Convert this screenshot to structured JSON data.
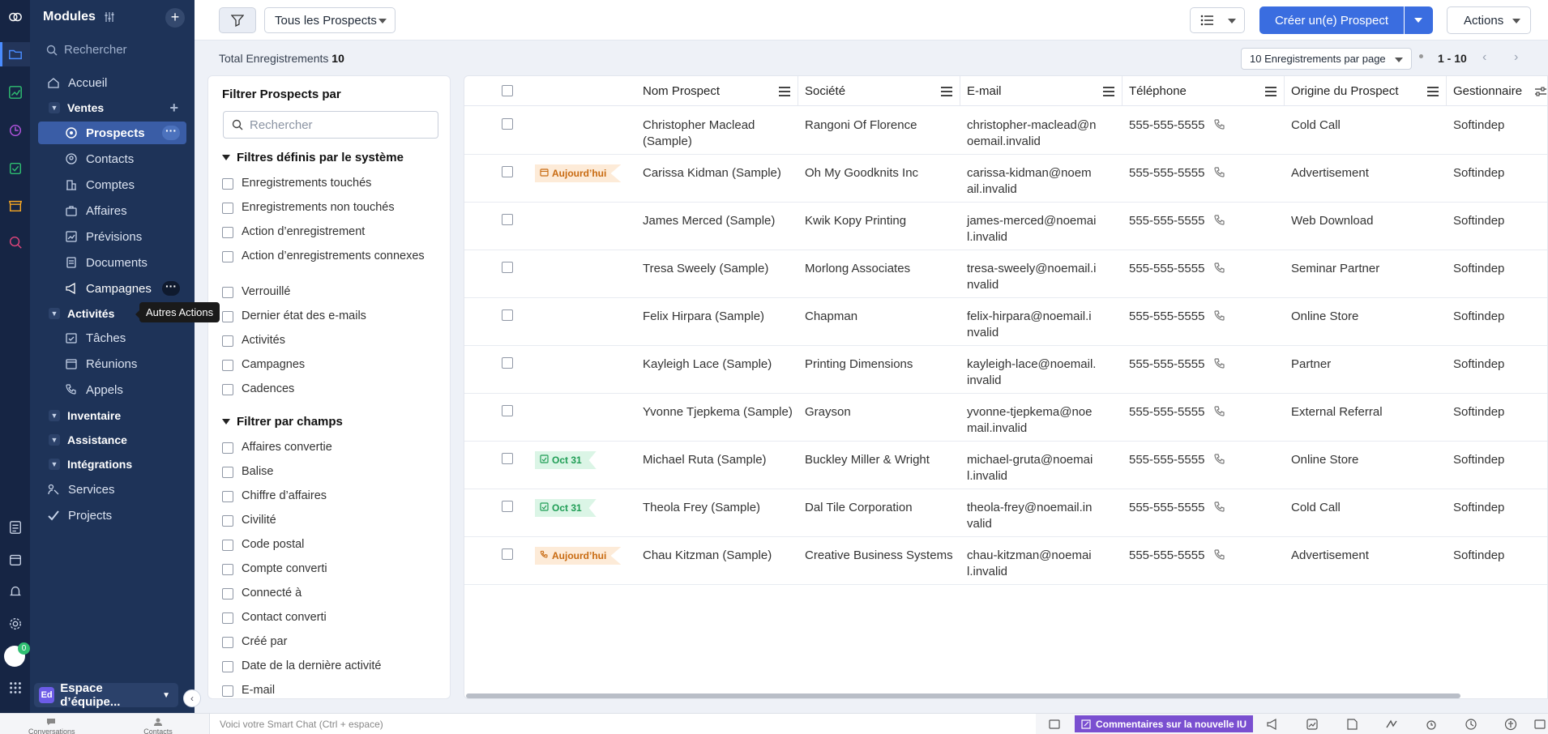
{
  "sidebar": {
    "header": "Modules",
    "search_placeholder": "Rechercher",
    "items": [
      {
        "label": "Accueil"
      },
      {
        "label": "Ventes"
      },
      {
        "label": "Prospects"
      },
      {
        "label": "Contacts"
      },
      {
        "label": "Comptes"
      },
      {
        "label": "Affaires"
      },
      {
        "label": "Prévisions"
      },
      {
        "label": "Documents"
      },
      {
        "label": "Campagnes"
      },
      {
        "label": "Activités"
      },
      {
        "label": "Tâches"
      },
      {
        "label": "Réunions"
      },
      {
        "label": "Appels"
      },
      {
        "label": "Inventaire"
      },
      {
        "label": "Assistance"
      },
      {
        "label": "Intégrations"
      },
      {
        "label": "Services"
      },
      {
        "label": "Projects"
      }
    ],
    "tooltip": "Autres Actions",
    "workspace_badge": "Ed",
    "workspace_label": "Espace d’équipe...",
    "notification_count": "0"
  },
  "toolbar": {
    "view_label": "Tous les Prospects",
    "create_label": "Créer un(e) Prospect",
    "actions_label": "Actions"
  },
  "summary": {
    "total_label": "Total Enregistrements",
    "total_count": "10",
    "per_page": "10 Enregistrements par page",
    "range": "1 - 10"
  },
  "filters": {
    "title": "Filtrer Prospects par",
    "search_placeholder": "Rechercher",
    "system_title": "Filtres définis par le système",
    "system": [
      "Enregistrements touchés",
      "Enregistrements non touchés",
      "Action d’enregistrement",
      "Action d’enregistrements connexes",
      "Verrouillé",
      "Dernier état des e-mails",
      "Activités",
      "Campagnes",
      "Cadences"
    ],
    "fields_title": "Filtrer par champs",
    "fields": [
      "Affaires convertie",
      "Balise",
      "Chiffre d’affaires",
      "Civilité",
      "Code postal",
      "Compte converti",
      "Connecté à",
      "Contact converti",
      "Créé par",
      "Date de la dernière activité",
      "E-mail"
    ]
  },
  "table": {
    "columns": [
      "Nom Prospect",
      "Société",
      "E-mail",
      "Téléphone",
      "Origine du Prospect",
      "Gestionnaire"
    ],
    "rows": [
      {
        "tag": "",
        "tag_type": "",
        "name": "Christopher Maclead (Sample)",
        "company": "Rangoni Of Florence",
        "email": "christopher-maclead@noemail.invalid",
        "phone": "555-555-5555",
        "source": "Cold Call",
        "owner": "Softindep"
      },
      {
        "tag": "Aujourd’hui",
        "tag_type": "today-calendar",
        "name": "Carissa Kidman (Sample)",
        "company": "Oh My Goodknits Inc",
        "email": "carissa-kidman@noemail.invalid",
        "phone": "555-555-5555",
        "source": "Advertisement",
        "owner": "Softindep"
      },
      {
        "tag": "",
        "tag_type": "",
        "name": "James Merced (Sample)",
        "company": "Kwik Kopy Printing",
        "email": "james-merced@noemail.invalid",
        "phone": "555-555-5555",
        "source": "Web Download",
        "owner": "Softindep"
      },
      {
        "tag": "",
        "tag_type": "",
        "name": "Tresa Sweely (Sample)",
        "company": "Morlong Associates",
        "email": "tresa-sweely@noemail.invalid",
        "phone": "555-555-5555",
        "source": "Seminar Partner",
        "owner": "Softindep"
      },
      {
        "tag": "",
        "tag_type": "",
        "name": "Felix Hirpara (Sample)",
        "company": "Chapman",
        "email": "felix-hirpara@noemail.invalid",
        "phone": "555-555-5555",
        "source": "Online Store",
        "owner": "Softindep"
      },
      {
        "tag": "",
        "tag_type": "",
        "name": "Kayleigh Lace (Sample)",
        "company": "Printing Dimensions",
        "email": "kayleigh-lace@noemail.invalid",
        "phone": "555-555-5555",
        "source": "Partner",
        "owner": "Softindep"
      },
      {
        "tag": "",
        "tag_type": "",
        "name": "Yvonne Tjepkema (Sample)",
        "company": "Grayson",
        "email": "yvonne-tjepkema@noemail.invalid",
        "phone": "555-555-5555",
        "source": "External Referral",
        "owner": "Softindep"
      },
      {
        "tag": "Oct 31",
        "tag_type": "date-task",
        "name": "Michael Ruta (Sample)",
        "company": "Buckley Miller & Wright",
        "email": "michael-gruta@noemail.invalid",
        "phone": "555-555-5555",
        "source": "Online Store",
        "owner": "Softindep"
      },
      {
        "tag": "Oct 31",
        "tag_type": "date-task",
        "name": "Theola Frey (Sample)",
        "company": "Dal Tile Corporation",
        "email": "theola-frey@noemail.invalid",
        "phone": "555-555-5555",
        "source": "Cold Call",
        "owner": "Softindep"
      },
      {
        "tag": "Aujourd’hui",
        "tag_type": "today-call",
        "name": "Chau Kitzman (Sample)",
        "company": "Creative Business Systems",
        "email": "chau-kitzman@noemail.invalid",
        "phone": "555-555-5555",
        "source": "Advertisement",
        "owner": "Softindep"
      }
    ]
  },
  "bottombar": {
    "conversations": "Conversations",
    "contacts": "Contacts",
    "smartchat_placeholder": "Voici votre Smart Chat (Ctrl + espace)",
    "feedback": "Commentaires sur la nouvelle IU"
  },
  "colors": {
    "sidebar": "#1e3358",
    "rail": "#162544",
    "primary": "#3a6de0",
    "selected": "#3a5da6",
    "today_tag": "#c86a10",
    "date_tag": "#1f9d55",
    "feedback": "#7a4fd0"
  }
}
